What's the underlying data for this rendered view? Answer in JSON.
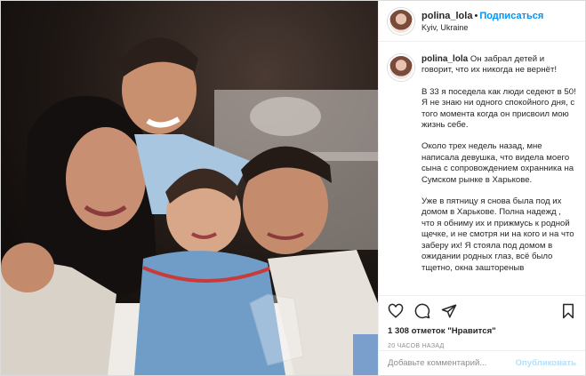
{
  "header": {
    "username": "polina_lola",
    "separator": "•",
    "follow_label": "Подписаться",
    "location": "Kyiv, Ukraine"
  },
  "caption": {
    "username": "polina_lola",
    "paragraphs": [
      "Он забрал детей и говорит, что их никогда не вернёт!",
      "В 33 я поседела как люди седеют в 50! Я не знаю ни одного спокойного дня, с того момента когда он присвоил мою жизнь себе.",
      "Около трех недель назад, мне написала девушка, что видела моего сына с сопровождением охранника на Сумском рынке в Харькове.",
      "Уже в пятницу я снова была под их домом в Харькове. Полна надежд , что я обниму их и прижмусь к родной щечке, и не смотря ни на кого и на что заберу их! Я стояла под домом в ожидании родных глаз, всё было тщетно, окна заштореныв"
    ]
  },
  "actions": {
    "icons": [
      "heart-icon",
      "comment-icon",
      "share-icon",
      "bookmark-icon"
    ],
    "likes_text": "1 308 отметок \"Нравится\"",
    "time_text": "20 ЧАСОВ НАЗАД"
  },
  "comment": {
    "placeholder": "Добавьте комментарий...",
    "publish_label": "Опубликовать"
  },
  "colors": {
    "accent": "#0095f6",
    "publish_disabled": "#b2dffc",
    "muted": "#8e8e8e"
  }
}
